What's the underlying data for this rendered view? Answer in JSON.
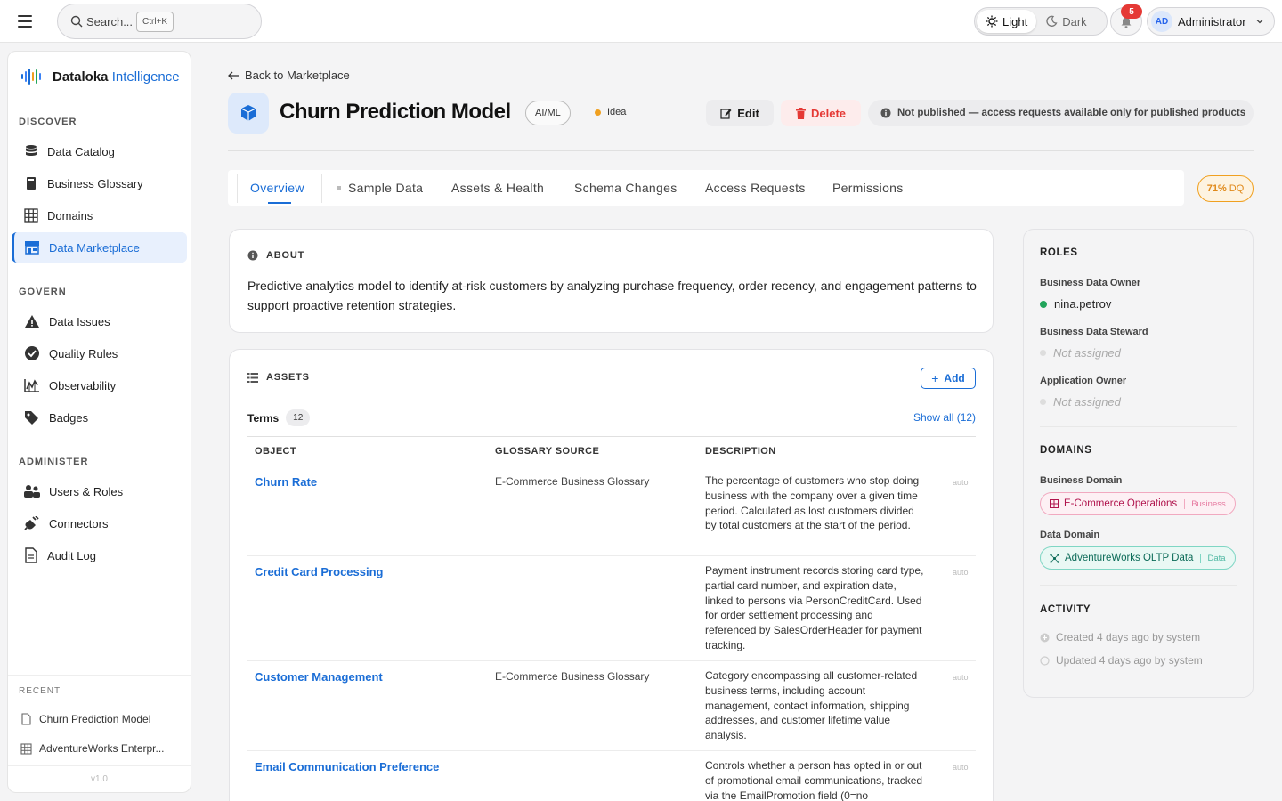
{
  "topbar": {
    "search_label": "Search...",
    "search_shortcut": "Ctrl+K",
    "theme_light": "Light",
    "theme_dark": "Dark",
    "notifications_count": "5",
    "user_initials": "AD",
    "user_name": "Administrator"
  },
  "sidebar": {
    "brand_name": "Dataloka",
    "brand_suffix": "Intelligence",
    "sections": {
      "discover": "DISCOVER",
      "govern": "GOVERN",
      "administer": "ADMINISTER",
      "recent": "RECENT"
    },
    "discover_items": [
      "Data Catalog",
      "Business Glossary",
      "Domains",
      "Data Marketplace"
    ],
    "govern_items": [
      "Data Issues",
      "Quality Rules",
      "Observability",
      "Badges"
    ],
    "administer_items": [
      "Users & Roles",
      "Connectors",
      "Audit Log"
    ],
    "recent_items": [
      "Churn Prediction Model",
      "AdventureWorks Enterpr..."
    ],
    "version": "v1.0"
  },
  "header": {
    "back_label": "Back to Marketplace",
    "title": "Churn Prediction Model",
    "category": "AI/ML",
    "status": "Idea",
    "edit_label": "Edit",
    "delete_label": "Delete",
    "publish_notice": "Not published — access requests available only for published products"
  },
  "tabs": [
    "Overview",
    "Sample Data",
    "Assets & Health",
    "Schema Changes",
    "Access Requests",
    "Permissions"
  ],
  "dq_score": "71%",
  "dq_suffix": "DQ",
  "about": {
    "heading": "ABOUT",
    "text": "Predictive analytics model to identify at-risk customers by analyzing purchase frequency, order recency, and engagement patterns to support proactive retention strategies."
  },
  "assets": {
    "heading": "ASSETS",
    "add_label": "Add",
    "terms_label": "Terms",
    "terms_count": "12",
    "show_all": "Show all (12)",
    "columns": [
      "OBJECT",
      "GLOSSARY SOURCE",
      "DESCRIPTION"
    ],
    "rows": [
      {
        "object": "Churn Rate",
        "source": "E-Commerce Business Glossary",
        "description": "The percentage of customers who stop doing business with the company over a given time period. Calculated as lost customers divided by total customers at the start of the period.",
        "tag": "auto"
      },
      {
        "object": "Credit Card Processing",
        "source": "",
        "description": "Payment instrument records storing card type, partial card number, and expiration date, linked to persons via PersonCreditCard. Used for order settlement processing and referenced by SalesOrderHeader for payment tracking.",
        "tag": "auto"
      },
      {
        "object": "Customer Management",
        "source": "E-Commerce Business Glossary",
        "description": "Category encompassing all customer-related business terms, including account management, contact information, shipping addresses, and customer lifetime value analysis.",
        "tag": "auto"
      },
      {
        "object": "Email Communication Preference",
        "source": "",
        "description": "Controls whether a person has opted in or out of promotional email communications, tracked via the EmailPromotion field (0=no",
        "tag": "auto"
      }
    ]
  },
  "roles": {
    "heading": "ROLES",
    "business_owner_label": "Business Data Owner",
    "business_owner": "nina.petrov",
    "steward_label": "Business Data Steward",
    "steward": "Not assigned",
    "app_owner_label": "Application Owner",
    "app_owner": "Not assigned"
  },
  "domains": {
    "heading": "DOMAINS",
    "business_label": "Business Domain",
    "business_name": "E-Commerce Operations",
    "business_tag": "Business",
    "data_label": "Data Domain",
    "data_name": "AdventureWorks OLTP Data",
    "data_tag": "Data"
  },
  "activity": {
    "heading": "ACTIVITY",
    "created": "Created 4 days ago by system",
    "updated": "Updated 4 days ago by system"
  },
  "colors": {
    "accent": "#1a6dd6",
    "danger": "#e53935",
    "warning": "#f0a020",
    "success": "#22a55b"
  }
}
